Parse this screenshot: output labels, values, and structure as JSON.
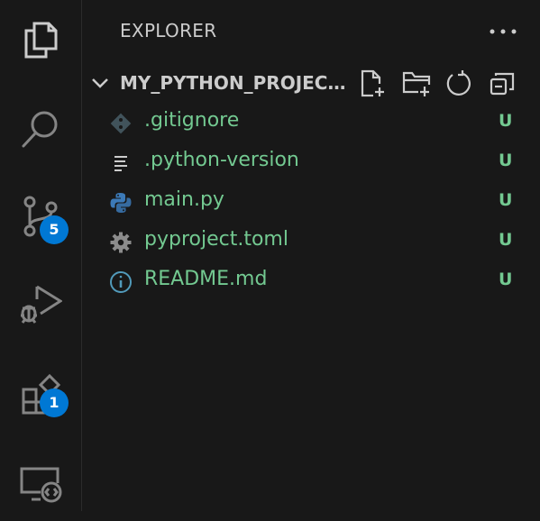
{
  "activity_bar": {
    "items": [
      {
        "name": "explorer",
        "icon": "files-icon"
      },
      {
        "name": "search",
        "icon": "search-icon"
      },
      {
        "name": "source-control",
        "icon": "source-control-icon",
        "badge": "5"
      },
      {
        "name": "run-debug",
        "icon": "run-debug-icon"
      },
      {
        "name": "extensions",
        "icon": "extensions-icon",
        "badge": "1"
      },
      {
        "name": "remote-explorer",
        "icon": "remote-explorer-icon"
      }
    ]
  },
  "sidebar": {
    "title": "EXPLORER",
    "more_icon": "ellipsis-icon",
    "section": {
      "title": "MY_PYTHON_PROJECT...",
      "tools": [
        "new-file-icon",
        "new-folder-icon",
        "refresh-icon",
        "collapse-all-icon"
      ]
    },
    "files": [
      {
        "name": ".gitignore",
        "icon": "git-icon",
        "status": "U"
      },
      {
        "name": ".python-version",
        "icon": "lines-icon",
        "status": "U"
      },
      {
        "name": "main.py",
        "icon": "python-icon",
        "status": "U"
      },
      {
        "name": "pyproject.toml",
        "icon": "gear-icon",
        "status": "U"
      },
      {
        "name": "README.md",
        "icon": "info-icon",
        "status": "U"
      }
    ]
  },
  "colors": {
    "background": "#181818",
    "icon_gray": "#858585",
    "badge": "#0078d4",
    "untracked_green": "#73c991"
  }
}
